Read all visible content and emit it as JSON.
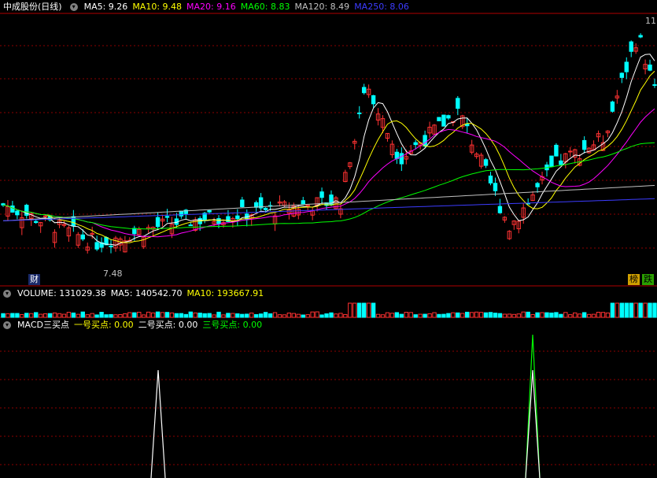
{
  "main_panel": {
    "title": "中成股份(日线)",
    "ma": [
      {
        "label": "MA5: 9.26",
        "color": "#ffffff"
      },
      {
        "label": "MA10: 9.48",
        "color": "#ffff00"
      },
      {
        "label": "MA20: 9.16",
        "color": "#ff00ff"
      },
      {
        "label": "MA60: 8.83",
        "color": "#00ff00"
      },
      {
        "label": "MA120: 8.49",
        "color": "#c0c0c0"
      },
      {
        "label": "MA250: 8.06",
        "color": "#3c3cff"
      }
    ],
    "high_label": "11",
    "low_label": "7.48",
    "tag_cai": "财",
    "tag_bang": "榜",
    "tag_die": "跌"
  },
  "volume_panel": {
    "items": [
      {
        "label": "VOLUME: 131029.38",
        "color": "#ffffff"
      },
      {
        "label": "MA5: 140542.70",
        "color": "#ffffff"
      },
      {
        "label": "MA10: 193667.91",
        "color": "#ffff00"
      }
    ]
  },
  "macd_panel": {
    "title": "MACD三买点",
    "items": [
      {
        "label": "一号买点: 0.00",
        "color": "#ffff00"
      },
      {
        "label": "二号买点: 0.00",
        "color": "#ffffff"
      },
      {
        "label": "三号买点: 0.00",
        "color": "#00ff00"
      }
    ]
  },
  "colors": {
    "up": "#ff3232",
    "down": "#00ffff",
    "grid": "#8b0000",
    "separator": "#b00000"
  },
  "chart_data": {
    "type": "candlestick",
    "x": [],
    "series": [
      {
        "name": "MA5",
        "values": []
      },
      {
        "name": "MA10",
        "values": []
      }
    ]
  }
}
